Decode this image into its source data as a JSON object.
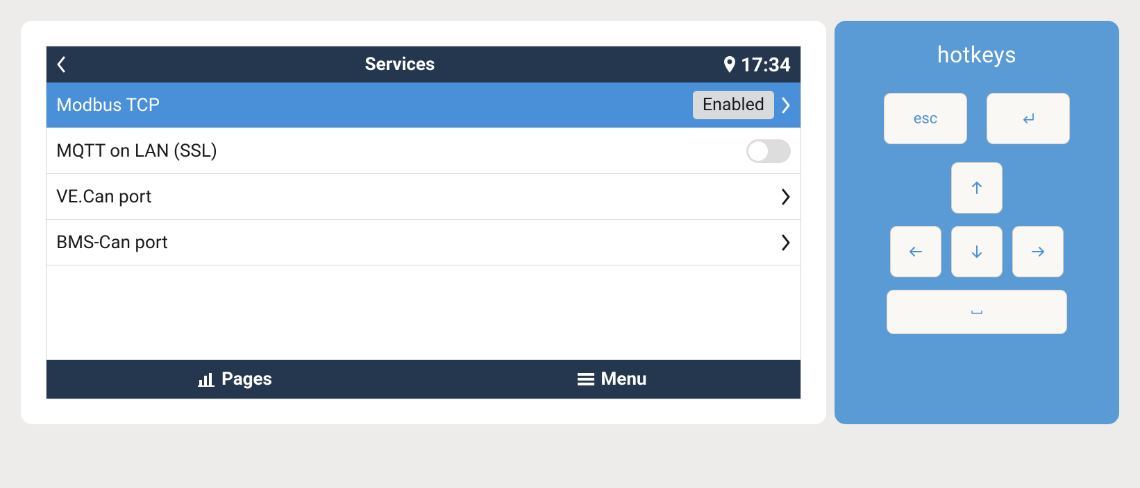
{
  "header": {
    "title": "Services",
    "time": "17:34"
  },
  "rows": [
    {
      "label": "Modbus TCP",
      "badge": "Enabled",
      "selected": true,
      "chevron": true
    },
    {
      "label": "MQTT on LAN (SSL)",
      "toggle": false
    },
    {
      "label": "VE.Can port",
      "chevron": true
    },
    {
      "label": "BMS-Can port",
      "chevron": true
    }
  ],
  "footer": {
    "pages": "Pages",
    "menu": "Menu"
  },
  "hotkeys": {
    "title": "hotkeys",
    "esc": "esc"
  }
}
